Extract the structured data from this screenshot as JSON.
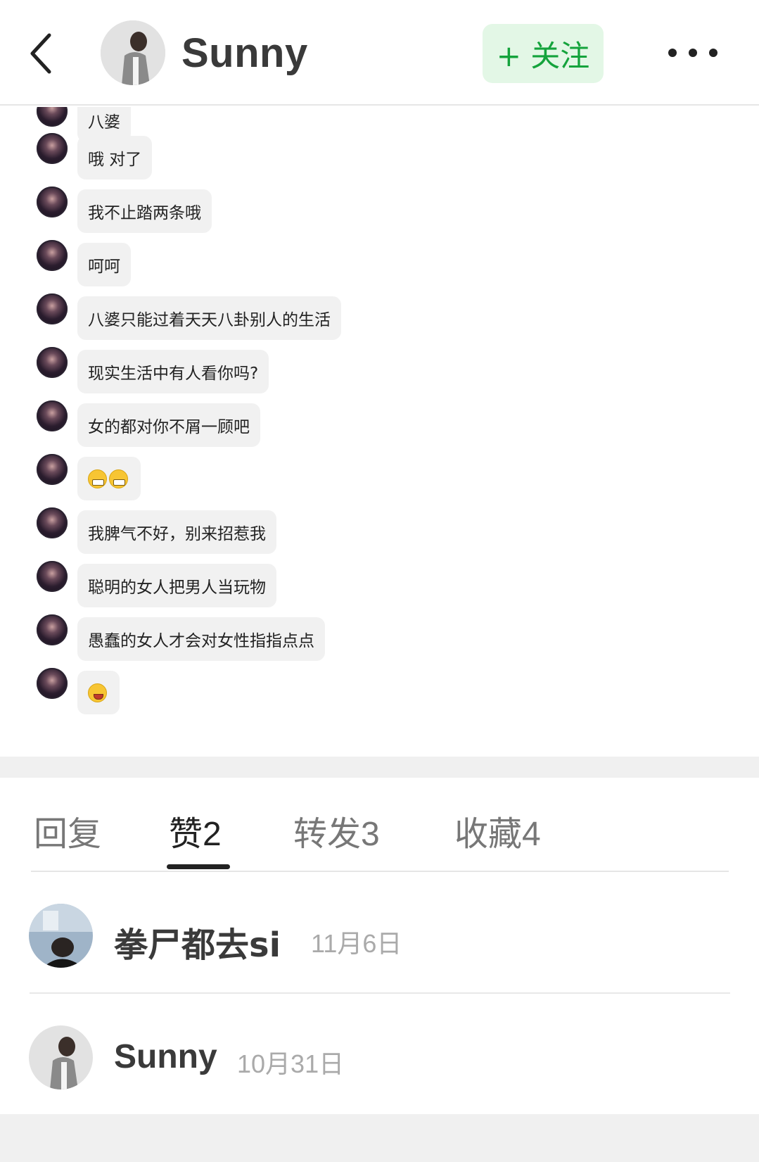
{
  "header": {
    "user_name": "Sunny",
    "follow_label": "+ 关注",
    "back_icon": "chevron-left-icon",
    "more_icon": "more-horizontal-icon"
  },
  "chat": {
    "messages": [
      {
        "text": "八婆"
      },
      {
        "text": "哦 对了"
      },
      {
        "text": "我不止踏两条哦"
      },
      {
        "text": "呵呵"
      },
      {
        "text": "八婆只能过着天天八卦别人的生活"
      },
      {
        "text": "现实生活中有人看你吗?"
      },
      {
        "text": "女的都对你不屑一顾吧"
      },
      {
        "text": "",
        "emoji": "grinning-emoji x2"
      },
      {
        "text": "我脾气不好，别来招惹我"
      },
      {
        "text": "聪明的女人把男人当玩物"
      },
      {
        "text": "愚蠢的女人才会对女性指指点点"
      },
      {
        "text": "",
        "emoji": "wink-tongue-emoji"
      }
    ]
  },
  "tabs": [
    {
      "label": "回复",
      "count": ""
    },
    {
      "label": "赞",
      "count": "2"
    },
    {
      "label": "转发",
      "count": "3"
    },
    {
      "label": "收藏",
      "count": "4"
    }
  ],
  "likes": [
    {
      "name": "拳尸都去si",
      "date": "11月6日"
    },
    {
      "name": "Sunny",
      "date": "10月31日"
    }
  ],
  "colors": {
    "accent_green": "#14a33c",
    "follow_bg": "#e3f7e6",
    "bubble_bg": "#f1f1f1",
    "band_gray": "#f0f0f0"
  }
}
